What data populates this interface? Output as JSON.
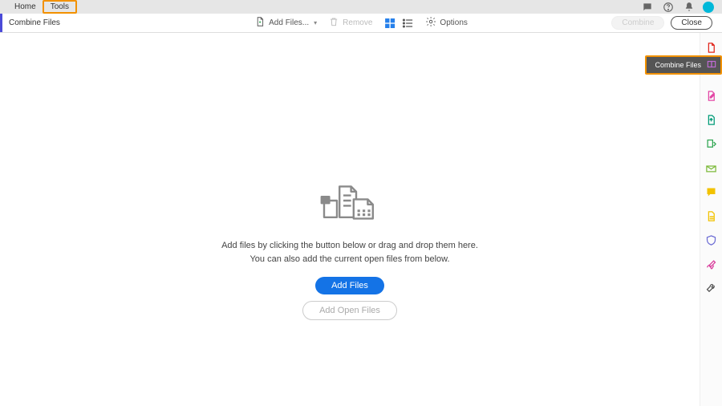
{
  "topbar": {
    "home_label": "Home",
    "tools_label": "Tools"
  },
  "subbar": {
    "title": "Combine Files",
    "add_files_label": "Add Files...",
    "remove_label": "Remove",
    "options_label": "Options",
    "combine_label": "Combine",
    "close_label": "Close"
  },
  "main": {
    "hint_line1": "Add files by clicking the button below or drag and drop them here.",
    "hint_line2": "You can also add the current open files from below.",
    "add_files_btn": "Add Files",
    "add_open_files_btn": "Add Open Files"
  },
  "rail": {
    "flyout_label": "Combine Files",
    "items": [
      {
        "name": "create-pdf-icon",
        "color": "#e1251b"
      },
      {
        "name": "combine-files-icon",
        "color": "#c06bd6"
      },
      {
        "name": "edit-pdf-icon",
        "color": "#e346a5"
      },
      {
        "name": "export-pdf-icon",
        "color": "#009b77"
      },
      {
        "name": "organize-pages-icon",
        "color": "#2ea550"
      },
      {
        "name": "send-comments-icon",
        "color": "#7cba3a"
      },
      {
        "name": "comment-icon",
        "color": "#f2c200"
      },
      {
        "name": "scan-ocr-icon",
        "color": "#f2c200"
      },
      {
        "name": "protect-icon",
        "color": "#6c6cd4"
      },
      {
        "name": "fill-sign-icon",
        "color": "#d83b9b"
      },
      {
        "name": "more-tools-icon",
        "color": "#555555"
      }
    ]
  }
}
